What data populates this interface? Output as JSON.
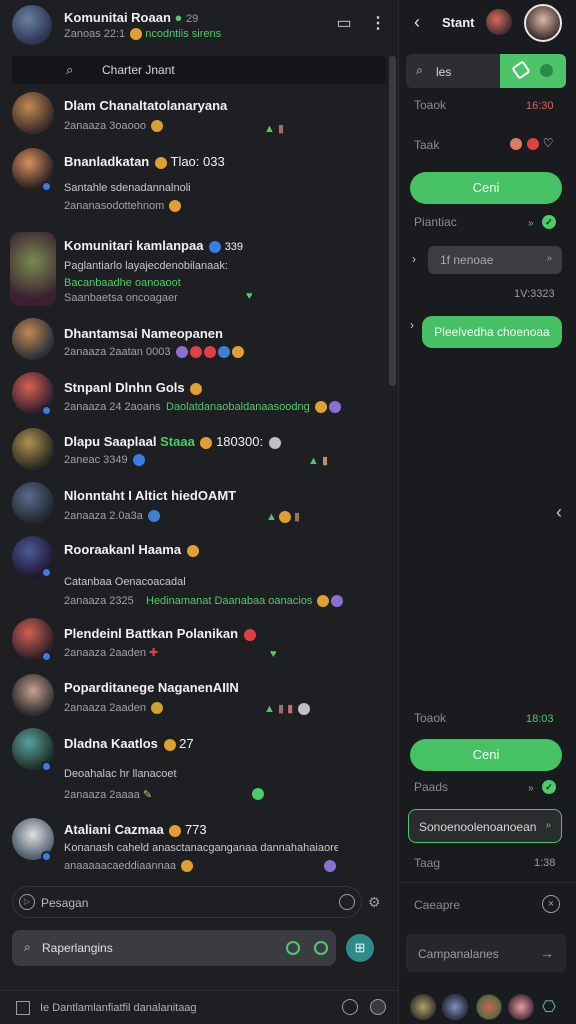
{
  "header": {
    "title": "Komunitai Roaan",
    "title_count": "29",
    "subtitle_prefix": "Zanoas 22:1",
    "subtitle_green": "ncodntiis sirens",
    "panel_icon": "panel-icon",
    "more_icon": "more-vertical-icon"
  },
  "search": {
    "icon": "search-icon",
    "label": "Charter Jnant"
  },
  "chats": [
    {
      "name": "Dlam Chanaltatolanaryana",
      "sub": "2anaaza 3oaooo",
      "prev": "",
      "green": "",
      "time": "",
      "marks": "▲ ▮"
    },
    {
      "name": "Bnanladkatan",
      "name2": "Tlao: 033",
      "sub": "Santahle sdenadannalnoli",
      "prev": "2ananasodottehnom",
      "green": "",
      "marks": ""
    },
    {
      "name": "Komunitari kamlanpaa",
      "name2": "339",
      "sub": "Paglantiarlo layajecdenobilanaak:",
      "prev": "",
      "green": "Bacanbaadhe oanoaoot",
      "green2": "Saanbaetsa oncoagaer",
      "marks": "♥"
    },
    {
      "name": "Dhantamsai Nameopanen",
      "sub": "2anaaza 2aatan 0003",
      "prev": "",
      "green": "",
      "marks": ""
    },
    {
      "name": "Stnpanl Dlnhn Gols",
      "sub": "2anaaza 24 2aoans",
      "prev": "",
      "green": "Daolatdanaobaldanaasoodng",
      "marks": ""
    },
    {
      "name": "Dlapu Saaplaal",
      "name2": "Staaa",
      "name3": "180300:",
      "sub": "2aneac 3349",
      "prev": "",
      "green": "",
      "marks": "▲ ▮"
    },
    {
      "name": "Nlonntaht I Altict hiedOAMT",
      "sub": "2anaaza 2.0a3a",
      "prev": "",
      "green": "",
      "marks": "▲ ▮"
    },
    {
      "name": "Rooraakanl Haama",
      "sub": "Catanbaa Oenacoacadal",
      "prev": "2anaaza 2325",
      "green": "Hedinamanat Daanabaa oanacios",
      "marks": ""
    },
    {
      "name": "Plendeinl Battkan Polanikan",
      "sub": "2anaaza 2aaden",
      "prev": "",
      "green": "",
      "marks": "♥"
    },
    {
      "name": "Poparditanege NaganenAIIN",
      "sub": "2anaaza 2aaden",
      "prev": "",
      "green": "",
      "marks": "▲ ▮"
    },
    {
      "name": "Dladna Kaatlos",
      "name2": "27",
      "sub": "Deoahalac hr llanacoet",
      "prev": "2anaaza 2aaaa",
      "green": "",
      "marks": ""
    },
    {
      "name": "Ataliani Cazmaa",
      "name2": "773",
      "sub": "Konanash caheld anasctanacganganaa dannahahaiaoreanale",
      "prev": "anaaaaacaeddiaannaa",
      "green": "",
      "marks": ""
    }
  ],
  "bottom": {
    "message_placeholder": "Pesagan",
    "search_label": "Raperlangins",
    "footer_text": "Ie Dantlamlanfiatfil danalanitaag"
  },
  "right": {
    "title": "Stant",
    "search_label": "les",
    "rows": [
      {
        "label": "Toaok",
        "value": "16:30",
        "tone": "red"
      },
      {
        "label": "Taak",
        "value": "",
        "tone": "red"
      },
      {
        "label": "Piantiac",
        "value": "»",
        "tone": "grn"
      },
      {
        "label": "",
        "value": "1V:3323",
        "tone": "gry"
      }
    ],
    "button1": "Ceni",
    "pill": "1f    nenoae",
    "green_pill": "Pleelvedha choenoaa",
    "bottom_label": "Toaok",
    "bottom_value": "18:03",
    "button2": "Ceni",
    "paads_label": "Paads",
    "outlined": "Sonoenoolenoanoean",
    "taag_label": "Taag",
    "taag_value": "1:38",
    "caeapre_label": "Caeapre",
    "compose_label": "Campanalanes"
  }
}
